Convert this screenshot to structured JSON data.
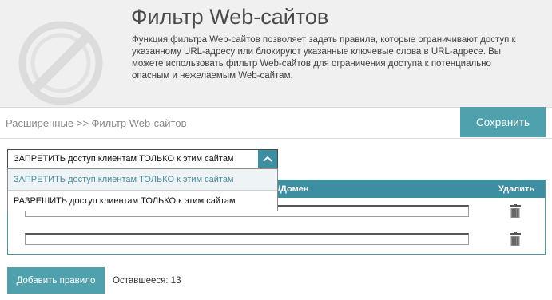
{
  "header": {
    "title": "Фильтр Web-сайтов",
    "description": "Функция фильтра Web-сайтов позволяет задать правила, которые ограничивают доступ к указанному URL-адресу или блокируют указанные ключевые слова в URL-адресе. Вы можете использовать фильтр Web-сайтов для ограничения доступа к потенциально опасным и нежелаемым Web-сайтам.",
    "logo_icon": "website-filter-icon"
  },
  "breadcrumb": "Расширенные >> Фильтр Web-сайтов",
  "toolbar": {
    "save_label": "Сохранить"
  },
  "filter_mode": {
    "selected": "ЗАПРЕТИТЬ доступ клиентам ТОЛЬКО к этим сайтам",
    "options": [
      "ЗАПРЕТИТЬ доступ клиентам ТОЛЬКО к этим сайтам",
      "РАЗРЕШИТЬ доступ клиентам ТОЛЬКО к этим сайтам"
    ],
    "arrow_icon": "chevron-up-icon"
  },
  "table": {
    "columns": {
      "domain": "/Домен",
      "delete": "Удалить"
    },
    "rows": [
      {
        "value": "",
        "delete_icon": "trash-icon"
      },
      {
        "value": "",
        "delete_icon": "trash-icon"
      }
    ]
  },
  "footer": {
    "add_rule_label": "Добавить правило",
    "remaining_label": "Оставшееся: 13"
  },
  "colors": {
    "accent": "#4fa1ad",
    "table_header": "#3c8ea0",
    "header_bg": "#f0f0f0"
  }
}
